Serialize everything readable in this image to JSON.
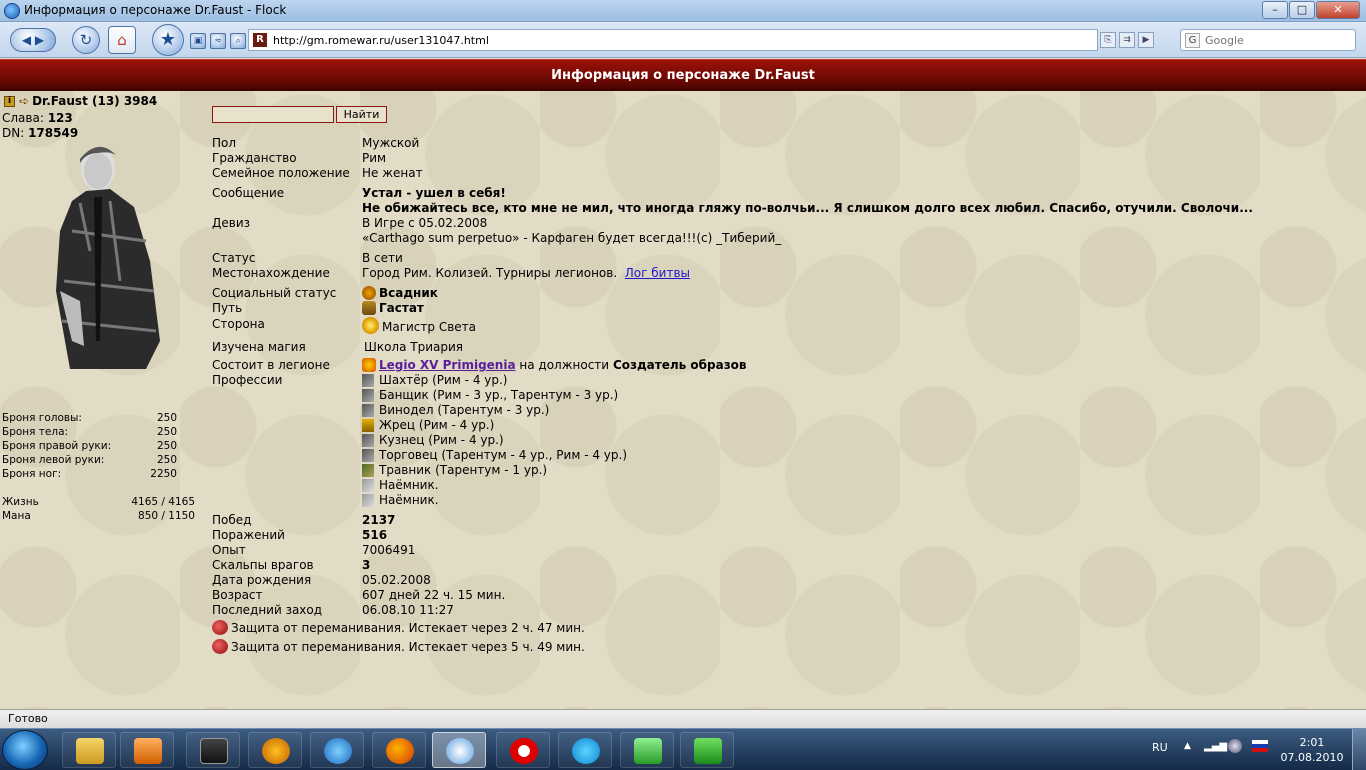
{
  "window": {
    "title": "Информация о персонаже Dr.Faust - Flock",
    "min": "–",
    "max": "□",
    "close": "✕"
  },
  "navbar": {
    "url": "http://gm.romewar.ru/user131047.html",
    "search_placeholder": "Google",
    "fav_letter": "R",
    "google_letter": "G"
  },
  "page": {
    "header": "Информация о персонаже Dr.Faust"
  },
  "character": {
    "name_line": "Dr.Faust (13) 3984",
    "slava_label": "Слава: ",
    "slava": "123",
    "dn_label": "DN: ",
    "dn": "178549",
    "stats": [
      {
        "label": "Броня головы:",
        "value": "250"
      },
      {
        "label": "Броня тела:",
        "value": "250"
      },
      {
        "label": "Броня правой руки:",
        "value": "250"
      },
      {
        "label": "Броня левой руки:",
        "value": "250"
      },
      {
        "label": "Броня ног:",
        "value": "2250"
      }
    ],
    "life_label": "Жизнь",
    "life": "4165 / 4165",
    "mana_label": "Мана",
    "mana": "850 / 1150"
  },
  "search": {
    "button": "Найти",
    "value": ""
  },
  "info": {
    "pol": {
      "label": "Пол",
      "value": "Мужской"
    },
    "citizenship": {
      "label": "Гражданство",
      "value": "Рим"
    },
    "family": {
      "label": "Семейное положение",
      "value": "Не женат"
    },
    "message": {
      "label": "Сообщение",
      "line1": "Устал - ушел в себя!",
      "line2": "Не обижайтесь все, кто мне не мил, что иногда гляжу по-волчьи... Я слишком долго всех любил. Спасибо, отучили. Сволочи..."
    },
    "motto": {
      "label": "Девиз",
      "line1": "В Игре с 05.02.2008",
      "line2": "«Carthago sum perpetuo» - Карфаген будет всегда!!!(с) _Тиберий_"
    },
    "status": {
      "label": "Статус",
      "value": "В сети"
    },
    "location": {
      "label": "Местонахождение",
      "value": "Город Рим. Колизей. Турниры легионов.",
      "link": "Лог битвы"
    },
    "social": {
      "label": "Социальный статус",
      "value": "Всадник"
    },
    "path": {
      "label": "Путь",
      "value": "Гастат"
    },
    "side": {
      "label": "Сторона",
      "value": "Магистр Света"
    },
    "magic": {
      "label": "Изучена магия",
      "value": "Школа Триария"
    },
    "legion": {
      "label": "Состоит в легионе",
      "name": "Legio XV Primigenia",
      "position_text": "на должности",
      "position": "Создатель образов"
    },
    "professions_label": "Профессии",
    "professions": [
      "Шахтёр (Рим - 4 ур.)",
      "Банщик (Рим - 3 ур., Тарентум - 3 ур.)",
      "Винодел (Тарентум - 3 ур.)",
      "Жрец (Рим - 4 ур.)",
      "Кузнец (Рим - 4 ур.)",
      "Торговец (Тарентум - 4 ур., Рим - 4 ур.)",
      "Травник (Тарентум - 1 ур.)",
      "Наёмник.",
      "Наёмник."
    ],
    "wins": {
      "label": "Побед",
      "value": "2137"
    },
    "losses": {
      "label": "Поражений",
      "value": "516"
    },
    "exp": {
      "label": "Опыт",
      "value": "7006491"
    },
    "scalps": {
      "label": "Скальпы врагов",
      "value": "3"
    },
    "birth": {
      "label": "Дата рождения",
      "value": "05.02.2008"
    },
    "age": {
      "label": "Возраст",
      "value": "607 дней 22 ч. 15 мин."
    },
    "last": {
      "label": "Последний заход",
      "value": "06.08.10 11:27"
    },
    "protections": [
      "Защита от переманивания. Истекает через 2 ч. 47 мин.",
      "Защита от переманивания. Истекает через 5 ч. 49 мин."
    ]
  },
  "statusbar": {
    "text": "Готово"
  },
  "taskbar": {
    "lang": "RU",
    "time": "2:01",
    "date": "07.08.2010"
  },
  "colors": {
    "header_red": "#7a0b05",
    "link": "#2018c8",
    "legion_link": "#5a1e9a",
    "bg": "#e2dcc6"
  }
}
